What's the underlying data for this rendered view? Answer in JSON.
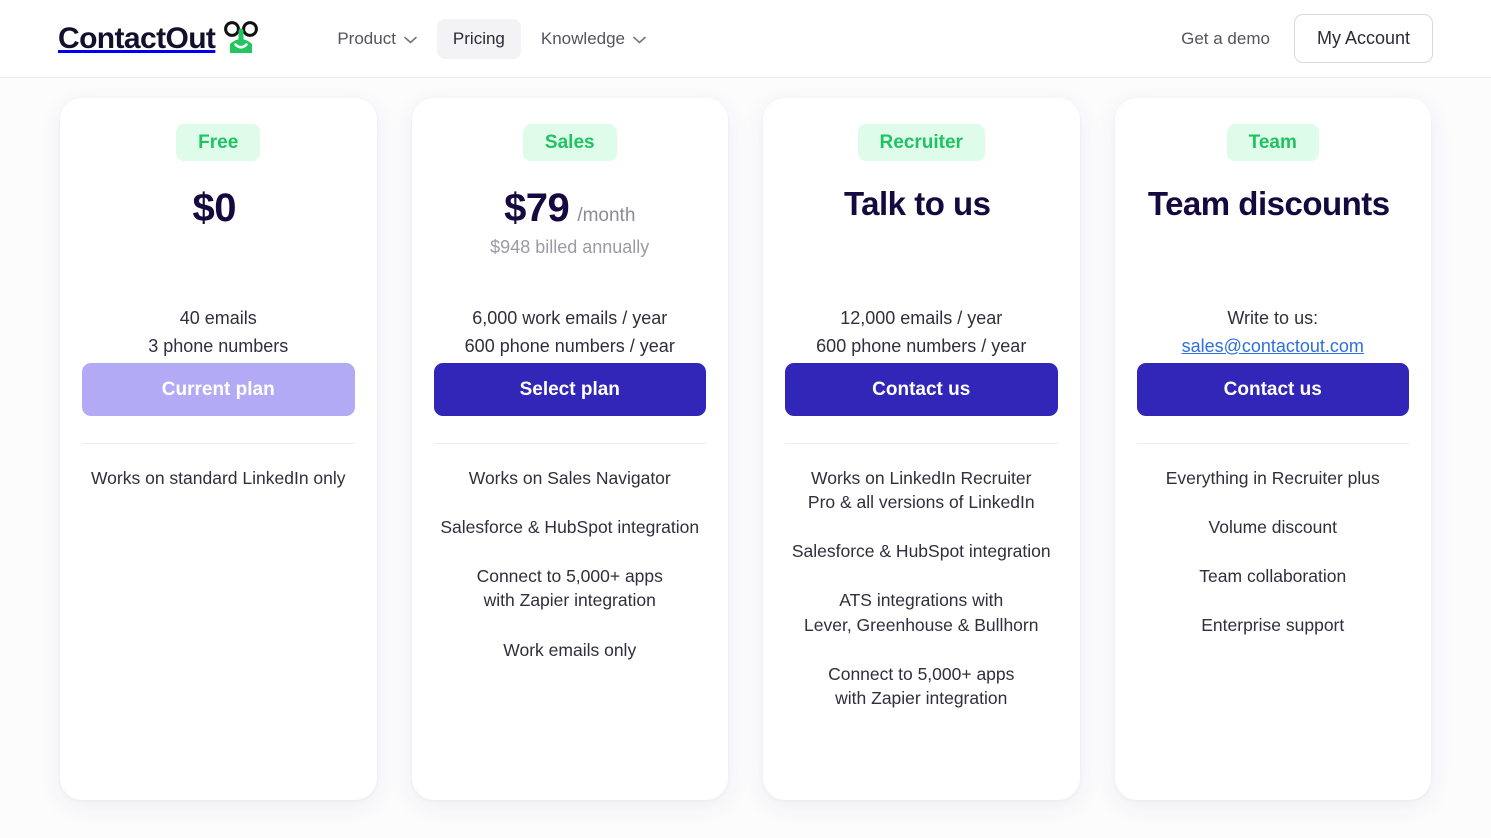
{
  "header": {
    "brand": {
      "wordmark": "ContactOut",
      "mascot_color": "#22c55e"
    },
    "nav": [
      {
        "label": "Product",
        "has_chevron": true,
        "active": false
      },
      {
        "label": "Pricing",
        "has_chevron": false,
        "active": true
      },
      {
        "label": "Knowledge",
        "has_chevron": true,
        "active": false
      }
    ],
    "demo_link": "Get a demo",
    "account_button": "My Account"
  },
  "colors": {
    "badge_bg": "#dffbe9",
    "badge_text": "#1fc363",
    "cta_primary": "#3226b8",
    "cta_disabled": "#b3aaf5",
    "price_text": "#15093f",
    "link": "#2f6fdd",
    "page_bg": "#fcfcfd"
  },
  "plans": [
    {
      "badge": "Free",
      "price_amount": "$0",
      "price_period": "",
      "price_billing": "",
      "price_is_wordy": false,
      "quota": [
        "40 emails",
        "3 phone numbers"
      ],
      "quota_link": "",
      "cta_label": "Current plan",
      "cta_state": "disabled",
      "features": [
        "Works on standard LinkedIn only"
      ]
    },
    {
      "badge": "Sales",
      "price_amount": "$79",
      "price_period": "/month",
      "price_billing": "$948 billed annually",
      "price_is_wordy": false,
      "quota": [
        "6,000 work emails / year",
        "600 phone numbers / year"
      ],
      "quota_link": "",
      "cta_label": "Select plan",
      "cta_state": "primary",
      "features": [
        "Works on Sales Navigator",
        "Salesforce & HubSpot integration",
        "Connect to 5,000+ apps\nwith Zapier integration",
        "Work emails only"
      ]
    },
    {
      "badge": "Recruiter",
      "price_amount": "Talk to us",
      "price_period": "",
      "price_billing": "",
      "price_is_wordy": true,
      "quota": [
        "12,000 emails / year",
        "600 phone numbers / year"
      ],
      "quota_link": "",
      "cta_label": "Contact us",
      "cta_state": "primary",
      "features": [
        "Works on LinkedIn Recruiter\nPro & all versions of LinkedIn",
        "Salesforce & HubSpot integration",
        "ATS integrations with\nLever, Greenhouse & Bullhorn",
        "Connect to 5,000+ apps\nwith Zapier integration"
      ]
    },
    {
      "badge": "Team",
      "price_amount": "Team discounts",
      "price_period": "",
      "price_billing": "",
      "price_is_wordy": true,
      "quota": [
        "Write to us:"
      ],
      "quota_link": "sales@contactout.com",
      "cta_label": "Contact us",
      "cta_state": "primary",
      "features": [
        "Everything in Recruiter plus",
        "Volume discount",
        "Team collaboration",
        "Enterprise support"
      ]
    }
  ]
}
